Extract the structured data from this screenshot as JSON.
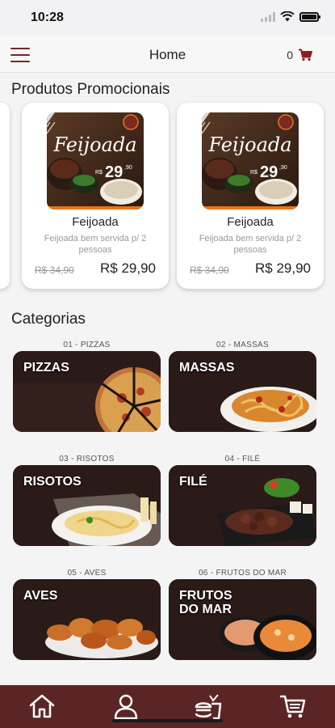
{
  "status": {
    "time": "10:28"
  },
  "appbar": {
    "title": "Home",
    "cart_count": "0"
  },
  "promo": {
    "section_title": "Produtos Promocionais",
    "items": [
      {
        "name": "Feijoada",
        "description": "Feijoada bem servida p/ 2 pessoas",
        "old_price": "R$ 34,90",
        "price": "R$ 29,90",
        "banner_title": "Feijoada",
        "banner_price": "29",
        "banner_cents": ",90",
        "banner_currency": "R$"
      },
      {
        "name": "Feijoada",
        "description": "Feijoada bem servida p/ 2 pessoas",
        "old_price": "R$ 34,90",
        "price": "R$ 29,90",
        "banner_title": "Feijoada",
        "banner_price": "29",
        "banner_cents": ",90",
        "banner_currency": "R$"
      }
    ]
  },
  "categories": {
    "section_title": "Categorias",
    "items": [
      {
        "caption": "01 - PIZZAS",
        "label": "PIZZAS"
      },
      {
        "caption": "02 - MASSAS",
        "label": "MASSAS"
      },
      {
        "caption": "03 - RISOTOS",
        "label": "RISOTOS"
      },
      {
        "caption": "04 - FILÉ",
        "label": "FILÉ"
      },
      {
        "caption": "05 - AVES",
        "label": "AVES"
      },
      {
        "caption": "06 - FRUTOS DO MAR",
        "label": "FRUTOS DO MAR"
      }
    ]
  },
  "bottom_nav": {
    "items": [
      "home-icon",
      "user-icon",
      "burger-icon",
      "cart-icon"
    ]
  },
  "colors": {
    "brand": "#5c2525",
    "accent": "#6b2a2a",
    "cart_red": "#8a1f1f",
    "banner_orange": "#e8731e"
  }
}
